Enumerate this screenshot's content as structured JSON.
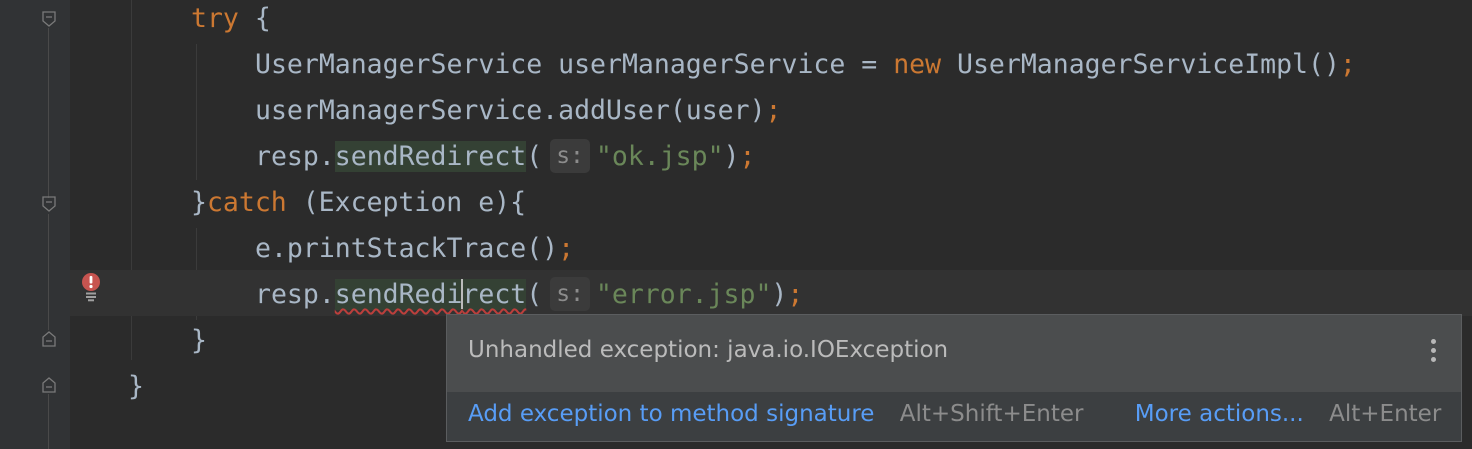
{
  "editor": {
    "lines": {
      "l1": {
        "kw": "try",
        "rest": " {"
      },
      "l2": {
        "a": "UserManagerService userManagerService = ",
        "kw": "new",
        "b": " UserManagerServiceImpl()",
        "semi": ";"
      },
      "l3": {
        "a": "userManagerService.addUser(user)",
        "semi": ";"
      },
      "l4": {
        "a": "resp.",
        "method": "sendRedirect",
        "paren": "(",
        "hint": "s:",
        "str": "\"ok.jsp\"",
        "close": ")",
        "semi": ";"
      },
      "l5": {
        "brace": "}",
        "kw": "catch",
        "rest": " (Exception e){"
      },
      "l6": {
        "a": "e.printStackTrace()",
        "semi": ";"
      },
      "l7": {
        "a": "resp.",
        "method_a": "sendRedi",
        "method_b": "rect",
        "paren": "(",
        "hint": "s:",
        "str": "\"error.jsp\"",
        "close": ")",
        "semi": ";"
      },
      "l8": {
        "text": "}"
      },
      "l9": {
        "text": "}"
      }
    },
    "error_icon": "error-bulb-icon",
    "colors": {
      "keyword": "#cc7832",
      "string": "#6a8759",
      "text": "#a9b7c6",
      "background": "#2b2b2b",
      "link": "#589df6"
    }
  },
  "popup": {
    "message": "Unhandled exception: java.io.IOException",
    "menu_icon": "more-vertical-icon",
    "action_primary": "Add exception to method signature",
    "action_primary_shortcut": "Alt+Shift+Enter",
    "action_more": "More actions...",
    "action_more_shortcut": "Alt+Enter"
  }
}
